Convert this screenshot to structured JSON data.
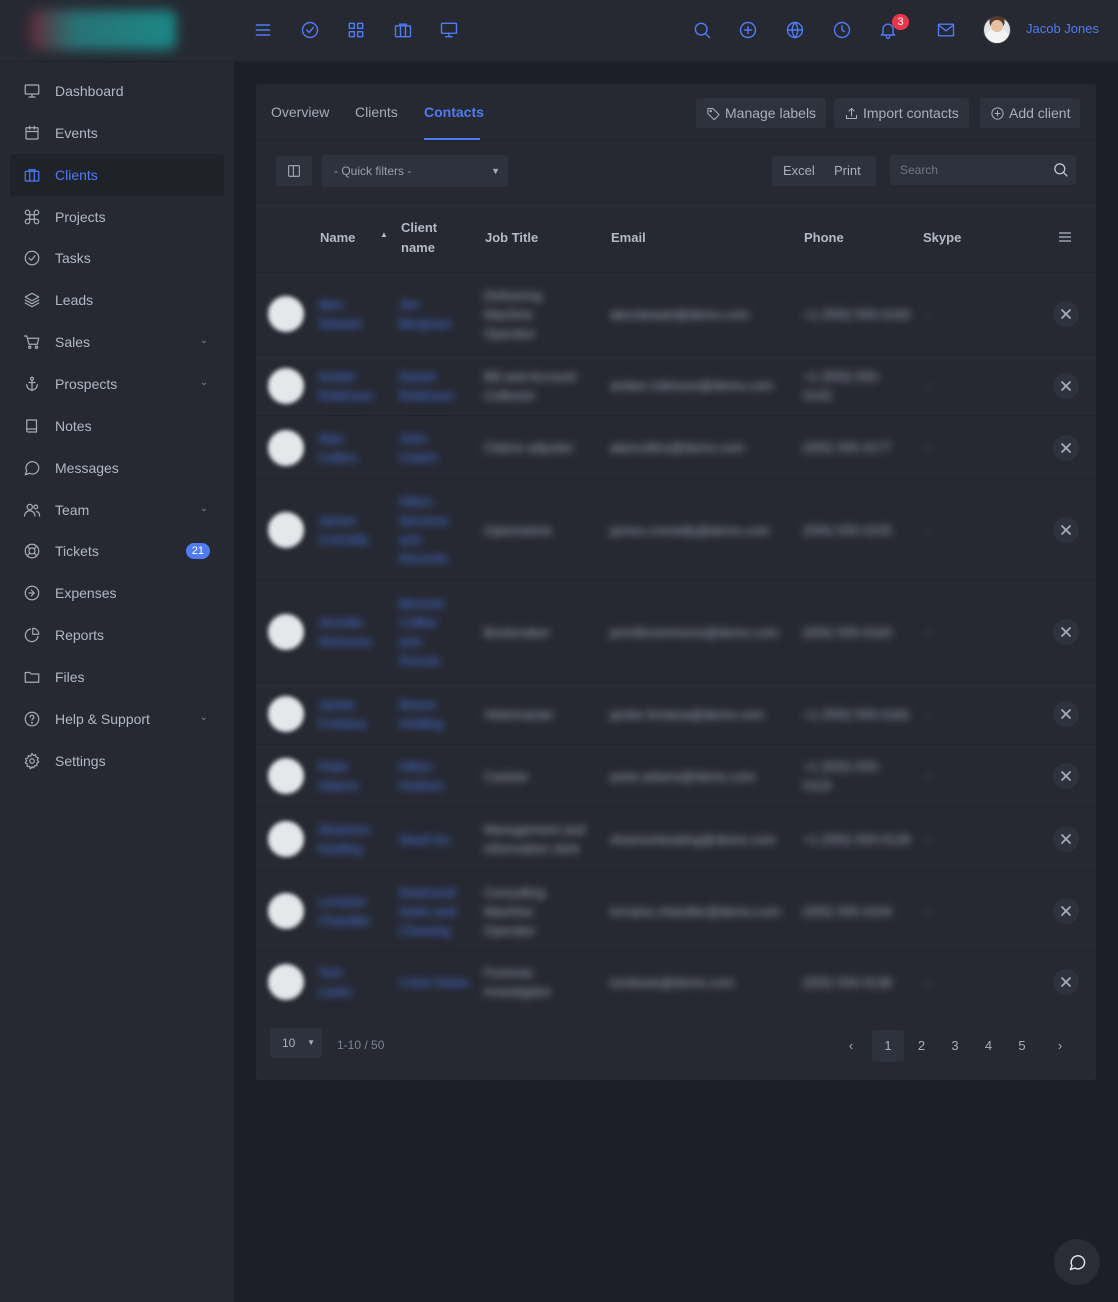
{
  "topbar": {
    "user_name": "Jacob Jones",
    "notification_count": "3",
    "accent_color": "#4f7bf5"
  },
  "sidebar": {
    "items": [
      {
        "label": "Dashboard",
        "icon": "monitor-icon"
      },
      {
        "label": "Events",
        "icon": "calendar-icon"
      },
      {
        "label": "Clients",
        "icon": "briefcase-icon",
        "active": true
      },
      {
        "label": "Projects",
        "icon": "command-icon"
      },
      {
        "label": "Tasks",
        "icon": "check-circle-icon"
      },
      {
        "label": "Leads",
        "icon": "layers-icon"
      },
      {
        "label": "Sales",
        "icon": "shopping-cart-icon",
        "has_submenu": true
      },
      {
        "label": "Prospects",
        "icon": "anchor-icon",
        "has_submenu": true
      },
      {
        "label": "Notes",
        "icon": "book-icon"
      },
      {
        "label": "Messages",
        "icon": "message-circle-icon"
      },
      {
        "label": "Team",
        "icon": "users-icon",
        "has_submenu": true
      },
      {
        "label": "Tickets",
        "icon": "life-buoy-icon",
        "badge": "21"
      },
      {
        "label": "Expenses",
        "icon": "arrow-right-circle-icon"
      },
      {
        "label": "Reports",
        "icon": "pie-chart-icon"
      },
      {
        "label": "Files",
        "icon": "folder-icon"
      },
      {
        "label": "Help & Support",
        "icon": "help-circle-icon",
        "has_submenu": true
      },
      {
        "label": "Settings",
        "icon": "settings-icon"
      }
    ]
  },
  "tabs": {
    "overview": "Overview",
    "clients": "Clients",
    "contacts": "Contacts"
  },
  "actions": {
    "manage_labels": "Manage labels",
    "import_contacts": "Import contacts",
    "add_client": "Add client"
  },
  "toolbar": {
    "quick_filters": "- Quick filters -",
    "excel": "Excel",
    "print": "Print",
    "search_placeholder": "Search"
  },
  "table": {
    "headers": {
      "name": "Name",
      "client_name_1": "Client",
      "client_name_2": "name",
      "job_title": "Job Title",
      "email": "Email",
      "phone": "Phone",
      "skype": "Skype"
    },
    "rows": [
      {
        "name": [
          "Alex",
          "Stewart"
        ],
        "client": [
          "Jim",
          "Bergman"
        ],
        "job": [
          "Delivering",
          "Machine",
          "Operator"
        ],
        "email": "alexstewart@demo.com",
        "phone": [
          "+1 (555) 555-0193"
        ],
        "skype": "-"
      },
      {
        "name": [
          "Amber",
          "Robinson"
        ],
        "client": [
          "Daniel",
          "Robinson"
        ],
        "job": [
          "Bill and Account",
          "Collector"
        ],
        "email": "amber.robinson@demo.com",
        "phone": [
          "+1 (555) 555-",
          "0142"
        ],
        "skype": "-"
      },
      {
        "name": [
          "Alan",
          "Collins"
        ],
        "client": [
          "John",
          "Coteril"
        ],
        "job": [
          "Claims adjuster"
        ],
        "email": "alancollins@demo.com",
        "phone": [
          "(555) 555-0177"
        ],
        "skype": "-"
      },
      {
        "name": [
          "James",
          "Connelly"
        ],
        "client": [
          "Hilton",
          "Services",
          "and",
          "Records"
        ],
        "job": [
          "Optometrist"
        ],
        "email": "james.connelly@demo.com",
        "phone": [
          "(555) 555-0155"
        ],
        "skype": "-"
      },
      {
        "name": [
          "Jennifer",
          "Simmons"
        ],
        "client": [
          "Bennett",
          "Coffee",
          "and",
          "Donuts"
        ],
        "job": [
          "Bookmaker"
        ],
        "email": "jennifersimmons@demo.com",
        "phone": [
          "(555) 555-0163"
        ],
        "skype": "-"
      },
      {
        "name": [
          "Jackie",
          "Fontana"
        ],
        "client": [
          "Moore",
          "Holding"
        ],
        "job": [
          "Veterinarian"
        ],
        "email": "jackie.fontana@demo.com",
        "phone": [
          "+1 (555) 555-0181"
        ],
        "skype": "-"
      },
      {
        "name": [
          "Peter",
          "Adams"
        ],
        "client": [
          "Hilton",
          "Hudson"
        ],
        "job": [
          "Cashier"
        ],
        "email": "peter.adams@demo.com",
        "phone": [
          "+1 (555) 555-",
          "0119"
        ],
        "skype": "-"
      },
      {
        "name": [
          "Shannon",
          "Keating"
        ],
        "client": [
          "Seed Inc."
        ],
        "job": [
          "Management and",
          "information clerk"
        ],
        "email": "shannonkeating@demo.com",
        "phone": [
          "+1 (555) 555-0128"
        ],
        "skype": "-"
      },
      {
        "name": [
          "Lorraine",
          "Chandler"
        ],
        "client": [
          "Redmond",
          "Swim and",
          "Cleaning"
        ],
        "job": [
          "Consulting",
          "Machine",
          "Operator"
        ],
        "email": "lorraine.chandler@demo.com",
        "phone": [
          "(555) 555-0104"
        ],
        "skype": "-"
      },
      {
        "name": [
          "Tom",
          "Lewis"
        ],
        "client": [
          "Crest Vision"
        ],
        "job": [
          "Forensic",
          "Investigator"
        ],
        "email": "tomlewis@demo.com",
        "phone": [
          "(555) 555-0138"
        ],
        "skype": "-"
      }
    ]
  },
  "pagination": {
    "page_size": "10",
    "info": "1-10 / 50",
    "prev": "‹",
    "next": "›",
    "pages": [
      "1",
      "2",
      "3",
      "4",
      "5"
    ],
    "current": "1"
  }
}
